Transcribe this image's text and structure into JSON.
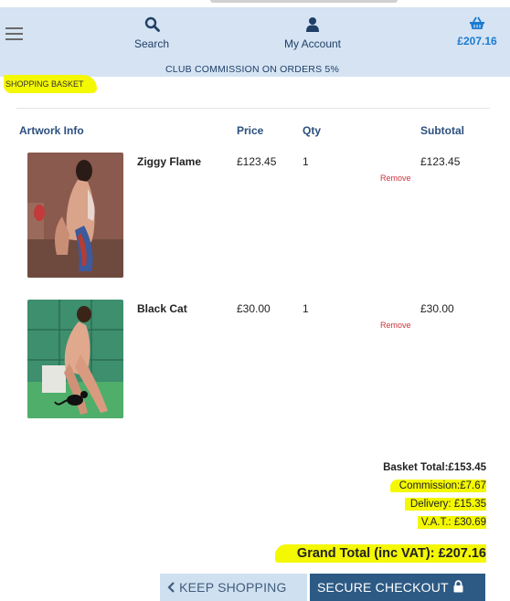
{
  "header": {
    "search_label": "Search",
    "account_label": "My Account",
    "basket_total": "£207.16",
    "commission_banner": "CLUB COMMISSION ON ORDERS 5%"
  },
  "page": {
    "title": "SHOPPING BASKET"
  },
  "table": {
    "headers": [
      "Artwork Info",
      "Price",
      "Qty",
      "Subtotal"
    ],
    "rows": [
      {
        "name": "Ziggy Flame",
        "price": "£123.45",
        "qty": "1",
        "subtotal": "£123.45",
        "remove": "Remove"
      },
      {
        "name": "Black Cat",
        "price": "£30.00",
        "qty": "1",
        "subtotal": "£30.00",
        "remove": "Remove"
      }
    ]
  },
  "totals": {
    "basket": "Basket Total:£153.45",
    "commission": "Commission:£7.67",
    "delivery": "Delivery: £15.35",
    "vat": "V.A.T.: £30.69",
    "grand": "Grand Total (inc VAT): £207.16"
  },
  "buttons": {
    "keep": "KEEP SHOPPING",
    "checkout": "SECURE CHECKOUT"
  },
  "colors": {
    "header_bg": "#d5e3f3",
    "highlight": "#f4f800",
    "checkout_bg": "#2d5a84",
    "remove": "#d0343c"
  }
}
